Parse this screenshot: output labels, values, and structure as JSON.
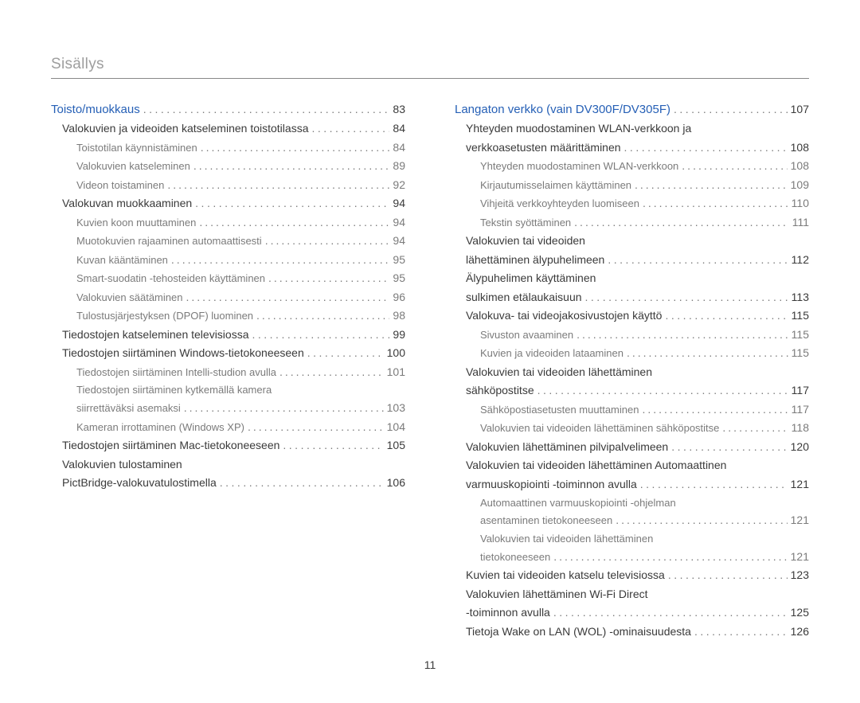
{
  "title": "Sisällys",
  "footer_page": "11",
  "left": [
    {
      "lvl": 0,
      "text": "Toisto/muokkaus",
      "page": "83"
    },
    {
      "lvl": 1,
      "text": "Valokuvien ja videoiden katseleminen toistotilassa",
      "page": "84"
    },
    {
      "lvl": 2,
      "text": "Toistotilan käynnistäminen",
      "page": "84"
    },
    {
      "lvl": 2,
      "text": "Valokuvien katseleminen",
      "page": "89"
    },
    {
      "lvl": 2,
      "text": "Videon toistaminen",
      "page": "92"
    },
    {
      "lvl": 1,
      "text": "Valokuvan muokkaaminen",
      "page": "94"
    },
    {
      "lvl": 2,
      "text": "Kuvien koon muuttaminen",
      "page": "94"
    },
    {
      "lvl": 2,
      "text": "Muotokuvien rajaaminen automaattisesti",
      "page": "94"
    },
    {
      "lvl": 2,
      "text": "Kuvan kääntäminen",
      "page": "95"
    },
    {
      "lvl": 2,
      "text": "Smart-suodatin -tehosteiden käyttäminen",
      "page": "95"
    },
    {
      "lvl": 2,
      "text": "Valokuvien säätäminen",
      "page": "96"
    },
    {
      "lvl": 2,
      "text": "Tulostusjärjestyksen (DPOF) luominen",
      "page": "98"
    },
    {
      "lvl": 1,
      "text": "Tiedostojen katseleminen televisiossa",
      "page": "99"
    },
    {
      "lvl": 1,
      "text": "Tiedostojen siirtäminen Windows-tietokoneeseen",
      "page": "100"
    },
    {
      "lvl": 2,
      "text": "Tiedostojen siirtäminen Intelli-studion avulla",
      "page": "101"
    },
    {
      "lvl": 2,
      "text": "Tiedostojen siirtäminen kytkemällä kamera",
      "page": "",
      "nopage": true
    },
    {
      "lvl": 2,
      "text": "siirrettäväksi asemaksi",
      "page": "103"
    },
    {
      "lvl": 2,
      "text": "Kameran irrottaminen (Windows XP)",
      "page": "104"
    },
    {
      "lvl": 1,
      "text": "Tiedostojen siirtäminen Mac-tietokoneeseen",
      "page": "105"
    },
    {
      "lvl": 1,
      "text": "Valokuvien tulostaminen",
      "page": "",
      "nopage": true
    },
    {
      "lvl": 1,
      "text": "PictBridge-valokuvatulostimella",
      "page": "106"
    }
  ],
  "right": [
    {
      "lvl": 0,
      "text": "Langaton verkko (vain DV300F/DV305F)",
      "page": "107"
    },
    {
      "lvl": 1,
      "text": "Yhteyden muodostaminen WLAN-verkkoon ja",
      "page": "",
      "nopage": true
    },
    {
      "lvl": 1,
      "text": "verkkoasetusten määrittäminen",
      "page": "108"
    },
    {
      "lvl": 2,
      "text": "Yhteyden muodostaminen WLAN-verkkoon",
      "page": "108"
    },
    {
      "lvl": 2,
      "text": "Kirjautumisselaimen käyttäminen",
      "page": "109"
    },
    {
      "lvl": 2,
      "text": "Vihjeitä verkkoyhteyden luomiseen",
      "page": "110"
    },
    {
      "lvl": 2,
      "text": "Tekstin syöttäminen",
      "page": "111"
    },
    {
      "lvl": 1,
      "text": "Valokuvien tai videoiden",
      "page": "",
      "nopage": true
    },
    {
      "lvl": 1,
      "text": "lähettäminen älypuhelimeen",
      "page": "112"
    },
    {
      "lvl": 1,
      "text": "Älypuhelimen käyttäminen",
      "page": "",
      "nopage": true
    },
    {
      "lvl": 1,
      "text": "sulkimen etälaukaisuun",
      "page": "113"
    },
    {
      "lvl": 1,
      "text": "Valokuva- tai videojakosivustojen käyttö",
      "page": "115"
    },
    {
      "lvl": 2,
      "text": "Sivuston avaaminen",
      "page": "115"
    },
    {
      "lvl": 2,
      "text": "Kuvien ja videoiden lataaminen",
      "page": "115"
    },
    {
      "lvl": 1,
      "text": "Valokuvien tai videoiden lähettäminen",
      "page": "",
      "nopage": true
    },
    {
      "lvl": 1,
      "text": "sähköpostitse",
      "page": "117"
    },
    {
      "lvl": 2,
      "text": "Sähköpostiasetusten muuttaminen",
      "page": "117"
    },
    {
      "lvl": 2,
      "text": "Valokuvien tai videoiden lähettäminen sähköpostitse",
      "page": "118"
    },
    {
      "lvl": 1,
      "text": "Valokuvien lähettäminen pilvipalvelimeen",
      "page": "120"
    },
    {
      "lvl": 1,
      "text": "Valokuvien tai videoiden lähettäminen Automaattinen",
      "page": "",
      "nopage": true
    },
    {
      "lvl": 1,
      "text": "varmuuskopiointi -toiminnon avulla",
      "page": "121"
    },
    {
      "lvl": 2,
      "text": "Automaattinen varmuuskopiointi -ohjelman",
      "page": "",
      "nopage": true
    },
    {
      "lvl": 2,
      "text": "asentaminen tietokoneeseen",
      "page": "121"
    },
    {
      "lvl": 2,
      "text": "Valokuvien tai videoiden lähettäminen",
      "page": "",
      "nopage": true
    },
    {
      "lvl": 2,
      "text": "tietokoneeseen",
      "page": "121"
    },
    {
      "lvl": 1,
      "text": "Kuvien tai videoiden katselu televisiossa",
      "page": "123"
    },
    {
      "lvl": 1,
      "text": "Valokuvien lähettäminen Wi-Fi Direct",
      "page": "",
      "nopage": true
    },
    {
      "lvl": 1,
      "text": "-toiminnon avulla",
      "page": "125"
    },
    {
      "lvl": 1,
      "text": "Tietoja Wake on LAN (WOL) -ominaisuudesta",
      "page": "126"
    }
  ]
}
